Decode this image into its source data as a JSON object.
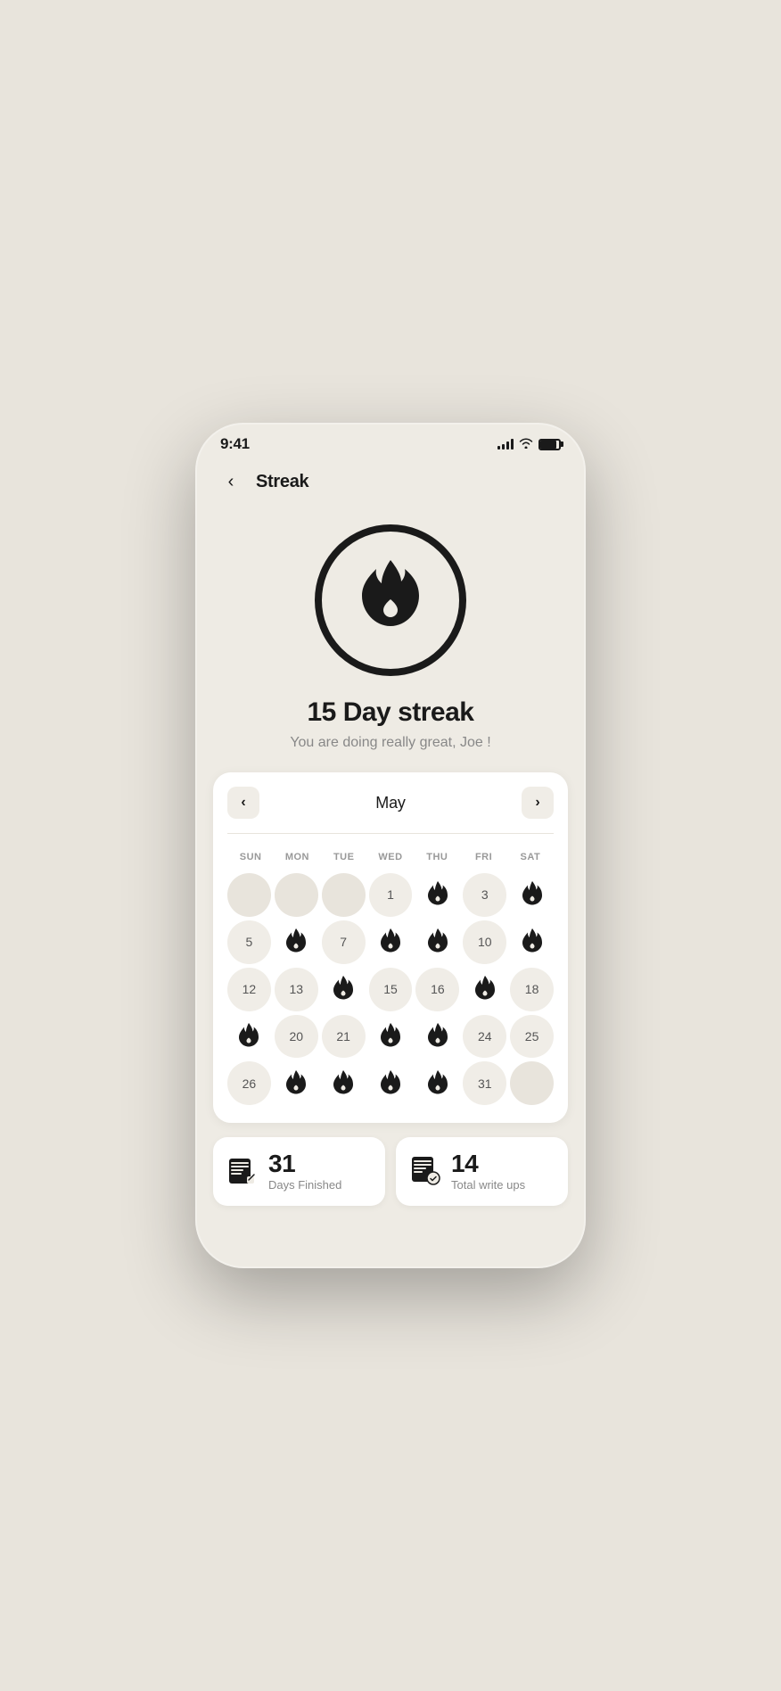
{
  "statusBar": {
    "time": "9:41",
    "signalBars": [
      4,
      6,
      8,
      11
    ],
    "batteryLevel": "85%"
  },
  "header": {
    "backLabel": "‹",
    "title": "Streak"
  },
  "streakInfo": {
    "title": "15 Day streak",
    "subtitle": "You are doing really great, Joe !"
  },
  "calendar": {
    "month": "May",
    "prevLabel": "‹",
    "nextLabel": "›",
    "dayHeaders": [
      "SUN",
      "MON",
      "TUE",
      "WED",
      "THU",
      "FRI",
      "SAT"
    ],
    "weeks": [
      [
        {
          "type": "empty",
          "value": ""
        },
        {
          "type": "empty",
          "value": ""
        },
        {
          "type": "empty",
          "value": ""
        },
        {
          "type": "number",
          "value": "1"
        },
        {
          "type": "flame",
          "value": ""
        },
        {
          "type": "number",
          "value": "3"
        },
        {
          "type": "flame",
          "value": ""
        }
      ],
      [
        {
          "type": "number",
          "value": "5"
        },
        {
          "type": "flame",
          "value": ""
        },
        {
          "type": "number",
          "value": "7"
        },
        {
          "type": "flame",
          "value": ""
        },
        {
          "type": "flame",
          "value": ""
        },
        {
          "type": "number",
          "value": "10"
        },
        {
          "type": "flame",
          "value": ""
        }
      ],
      [
        {
          "type": "number",
          "value": "12"
        },
        {
          "type": "number",
          "value": "13"
        },
        {
          "type": "flame",
          "value": ""
        },
        {
          "type": "number",
          "value": "15"
        },
        {
          "type": "number",
          "value": "16"
        },
        {
          "type": "flame",
          "value": ""
        },
        {
          "type": "number",
          "value": "18"
        }
      ],
      [
        {
          "type": "flame",
          "value": ""
        },
        {
          "type": "number",
          "value": "20"
        },
        {
          "type": "number",
          "value": "21"
        },
        {
          "type": "flame",
          "value": ""
        },
        {
          "type": "flame",
          "value": ""
        },
        {
          "type": "number",
          "value": "24"
        },
        {
          "type": "number",
          "value": "25"
        }
      ],
      [
        {
          "type": "number",
          "value": "26"
        },
        {
          "type": "flame",
          "value": ""
        },
        {
          "type": "flame",
          "value": ""
        },
        {
          "type": "flame",
          "value": ""
        },
        {
          "type": "flame",
          "value": ""
        },
        {
          "type": "number",
          "value": "31"
        },
        {
          "type": "empty",
          "value": ""
        }
      ]
    ]
  },
  "stats": {
    "daysFinished": {
      "number": "31",
      "label": "Days Finished",
      "icon": "📋"
    },
    "totalWriteUps": {
      "number": "14",
      "label": "Total write ups",
      "icon": "📝"
    }
  }
}
